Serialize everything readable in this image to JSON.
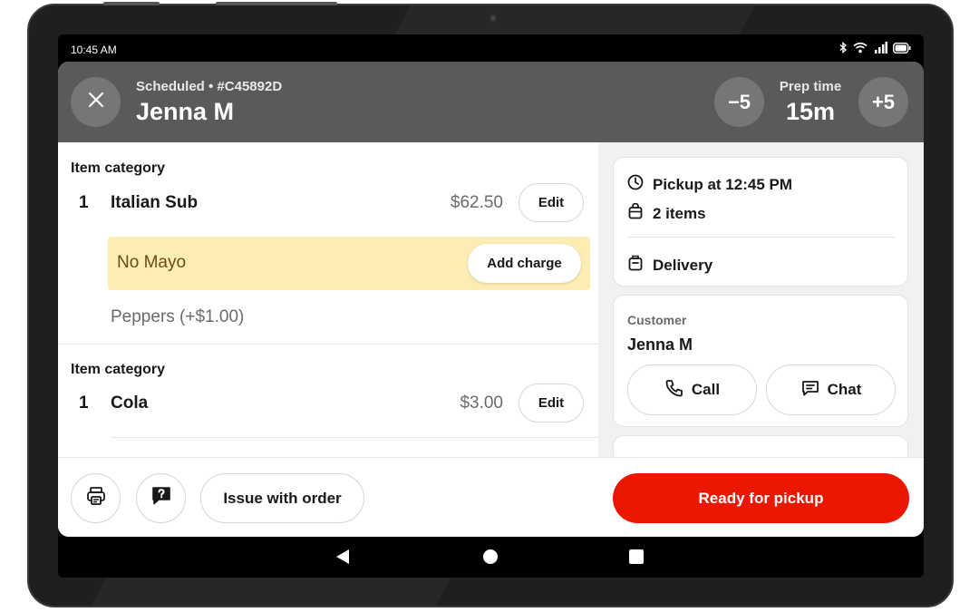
{
  "status_bar": {
    "time": "10:45 AM"
  },
  "header": {
    "order_meta": "Scheduled • #C45892D",
    "customer_name": "Jenna M",
    "prep_minus_label": "−5",
    "prep_plus_label": "+5",
    "prep_time_label": "Prep time",
    "prep_time_value": "15m"
  },
  "items": [
    {
      "category": "Item category",
      "qty": "1",
      "name": "Italian Sub",
      "price": "$62.50",
      "edit_label": "Edit",
      "note": "No Mayo",
      "note_action": "Add charge",
      "modifier": "Peppers (+$1.00)"
    },
    {
      "category": "Item category",
      "qty": "1",
      "name": "Cola",
      "price": "$3.00",
      "edit_label": "Edit"
    }
  ],
  "summary": {
    "pickup_time": "Pickup at 12:45 PM",
    "item_count": "2 items",
    "fulfillment": "Delivery"
  },
  "customer": {
    "label": "Customer",
    "name": "Jenna M",
    "call_label": "Call",
    "chat_label": "Chat"
  },
  "footer": {
    "issue_label": "Issue with order",
    "ready_label": "Ready for pickup"
  },
  "colors": {
    "primary_red": "#eb1700",
    "header_gray": "#5a5a5a",
    "note_yellow": "#fcedb4"
  },
  "icons": [
    "close-icon",
    "clock-icon",
    "bag-icon",
    "delivery-bag-icon",
    "phone-icon",
    "chat-icon",
    "printer-icon",
    "help-chat-icon",
    "bluetooth-icon",
    "wifi-icon",
    "signal-icon",
    "battery-icon"
  ]
}
